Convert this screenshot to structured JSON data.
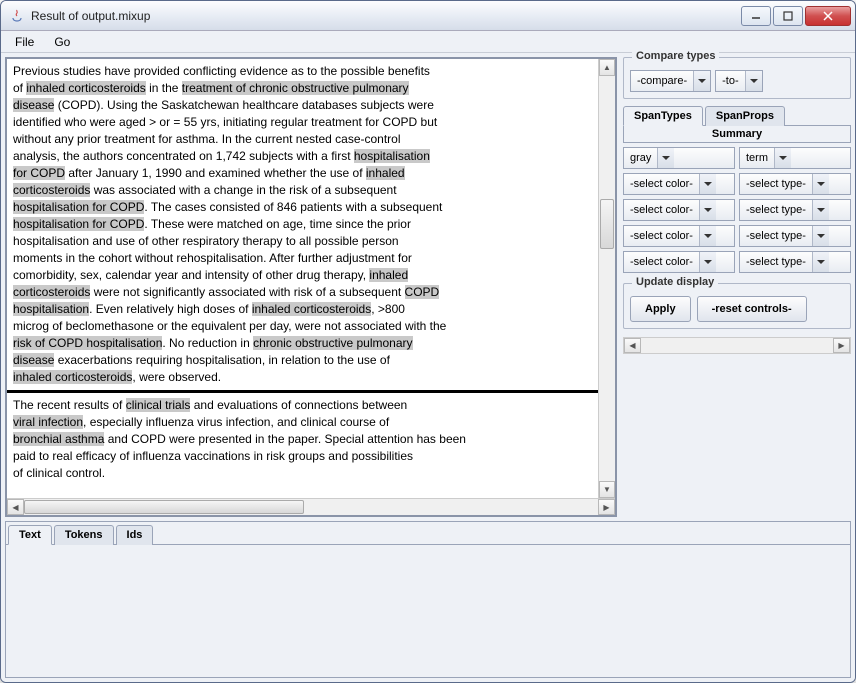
{
  "window": {
    "title": "Result of output.mixup"
  },
  "menu": {
    "file": "File",
    "go": "Go"
  },
  "doc1": {
    "p0a": "Previous studies have provided conflicting evidence as to the possible benefits",
    "p0b": "of ",
    "h1": "inhaled corticosteroids",
    "p0c": " in the ",
    "h2": "treatment of chronic obstructive pulmonary",
    "h2b": "disease",
    "p0d": " (COPD). Using the Saskatchewan healthcare databases subjects were",
    "p1": "identified who were aged > or = 55 yrs, initiating regular treatment for COPD but",
    "p2": "without any prior treatment for asthma. In the current nested case-control",
    "p3a": "analysis, the authors concentrated on 1,742 subjects with a first ",
    "h3": "hospitalisation",
    "h3b": "for COPD",
    "p3b": " after January 1, 1990 and examined whether the use of ",
    "h4": "inhaled",
    "h4b": "corticosteroids",
    "p3c": " was associated with a change in the risk of a subsequent",
    "h5": "hospitalisation for COPD",
    "p4a": ". The cases consisted of 846 patients with a subsequent",
    "h6": "hospitalisation for COPD",
    "p4b": ". These were matched on age, time since the prior",
    "p5": "hospitalisation and use of other respiratory therapy to all possible person",
    "p6": "moments in the cohort without rehospitalisation. After further adjustment for",
    "p7a": "comorbidity, sex, calendar year and intensity of other drug therapy, ",
    "h7": "inhaled",
    "h7b": "corticosteroids",
    "p7b": " were not significantly associated with risk of a subsequent ",
    "h8": "COPD",
    "h8b": "hospitalisation",
    "p7c": ". Even relatively high doses of ",
    "h9": "inhaled corticosteroids",
    "p7d": ", >800",
    "p8": "microg of beclomethasone or the equivalent per day, were not associated with the",
    "h10": "risk of COPD hospitalisation",
    "p9a": ". No reduction in ",
    "h11": "chronic obstructive pulmonary",
    "h11b": "disease",
    "p9b": " exacerbations requiring hospitalisation, in relation to the use of",
    "h12": "inhaled corticosteroids",
    "p9c": ", were observed."
  },
  "doc2": {
    "p0a": "The recent results of ",
    "h1": "clinical trials",
    "p0b": " and evaluations of connections between",
    "h2": "viral infection",
    "p1a": ", especially influenza virus infection, and clinical course of",
    "h3": "bronchial asthma",
    "p1b": " and COPD were presented in the paper. Special attention has been",
    "p2": "paid to real efficacy of influenza vaccinations in risk groups and possibilities",
    "p3": "of clinical control."
  },
  "compare": {
    "legend": "Compare types",
    "left": "-compare-",
    "right": "-to-"
  },
  "spantabs": {
    "types": "SpanTypes",
    "props": "SpanProps",
    "summary": "Summary"
  },
  "selectors": {
    "r1c": "gray",
    "r1t": "term",
    "r2c": "-select color-",
    "r2t": "-select type-",
    "r3c": "-select color-",
    "r3t": "-select type-",
    "r4c": "-select color-",
    "r4t": "-select type-",
    "r5c": "-select color-",
    "r5t": "-select type-"
  },
  "update": {
    "legend": "Update display",
    "apply": "Apply",
    "reset": "-reset controls-"
  },
  "lowertabs": {
    "text": "Text",
    "tokens": "Tokens",
    "ids": "Ids"
  }
}
